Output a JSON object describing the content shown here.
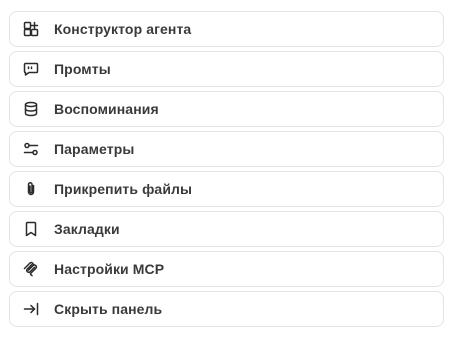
{
  "menu": {
    "items": [
      {
        "label": "Конструктор агента",
        "icon": "agent-builder-icon"
      },
      {
        "label": "Промты",
        "icon": "prompt-bubble-icon"
      },
      {
        "label": "Воспоминания",
        "icon": "database-icon"
      },
      {
        "label": "Параметры",
        "icon": "sliders-icon"
      },
      {
        "label": "Прикрепить файлы",
        "icon": "paperclip-icon"
      },
      {
        "label": "Закладки",
        "icon": "bookmark-icon"
      },
      {
        "label": "Настройки MCP",
        "icon": "mcp-icon"
      },
      {
        "label": "Скрыть панель",
        "icon": "collapse-panel-icon"
      }
    ]
  }
}
